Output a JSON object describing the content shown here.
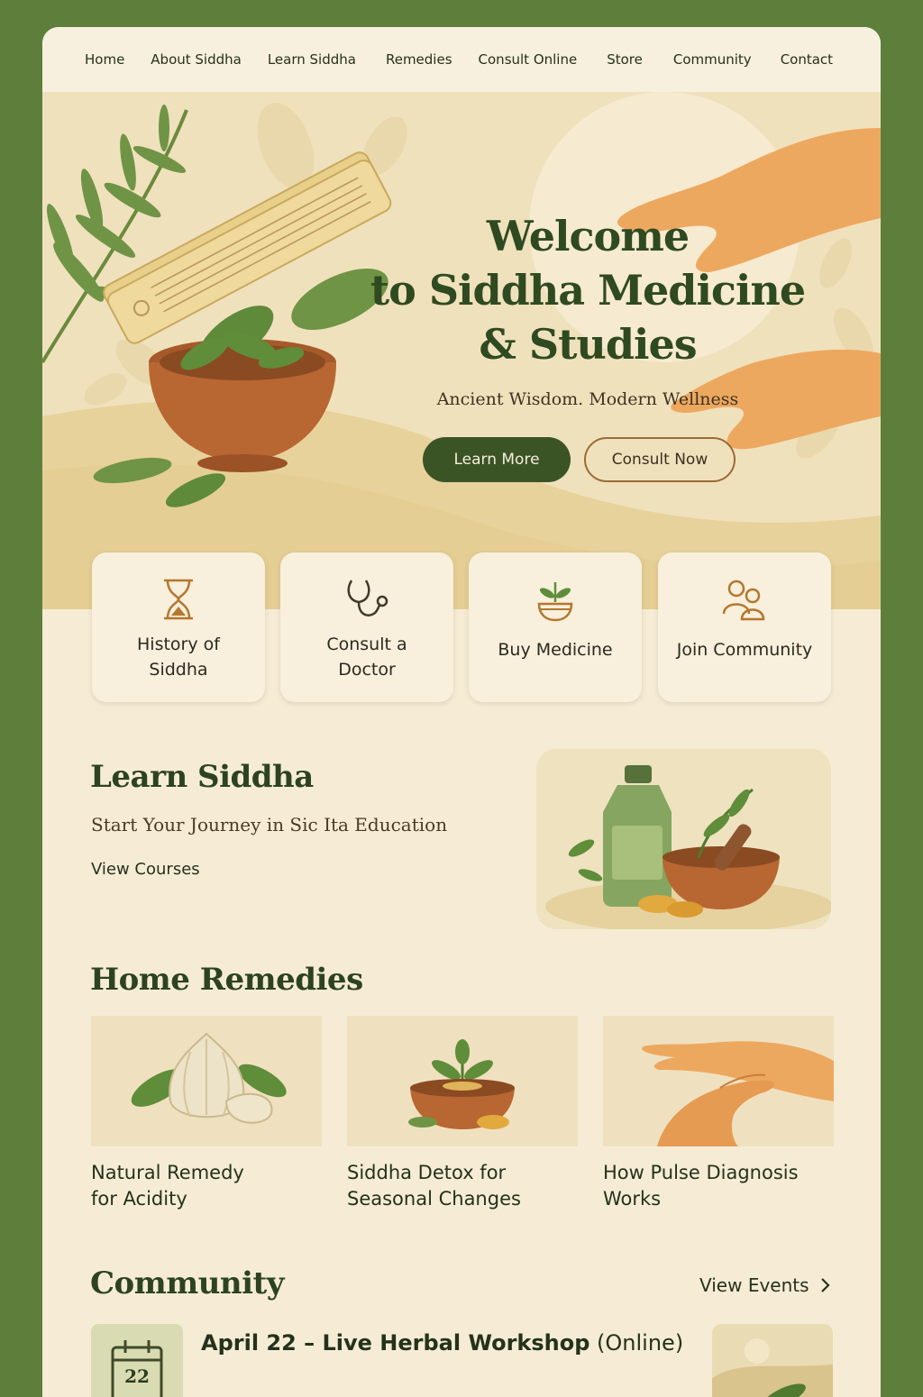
{
  "nav": {
    "items": [
      "Home",
      "About Siddha",
      "Learn Siddha",
      "Remedies",
      "Consult Online",
      "Store",
      "Community",
      "Contact"
    ]
  },
  "hero": {
    "title_line1": "Welcome",
    "title_line2": "to Siddha Medicine",
    "title_line3": "& Studies",
    "subtitle": "Ancient Wisdom. Modern Wellness",
    "primary_button": "Learn More",
    "secondary_button": "Consult Now"
  },
  "quick_links": [
    {
      "label_line1": "History of",
      "label_line2": "Siddha",
      "icon": "hourglass-icon"
    },
    {
      "label_line1": "Consult a",
      "label_line2": "Doctor",
      "icon": "stethoscope-icon"
    },
    {
      "label_line1": "Buy Medicine",
      "label_line2": "",
      "icon": "herb-bowl-icon"
    },
    {
      "label_line1": "Join Community",
      "label_line2": "",
      "icon": "people-icon"
    }
  ],
  "learn": {
    "title": "Learn Siddha",
    "subtitle": "Start Your Journey in Sic Ita Education",
    "link": "View Courses"
  },
  "remedies": {
    "title": "Home Remedies",
    "items": [
      {
        "line1": "Natural Remedy",
        "line2": "for Acidity"
      },
      {
        "line1": "Siddha Detox for",
        "line2": "Seasonal Changes"
      },
      {
        "line1": "How Pulse Diagnosis",
        "line2": "Works"
      }
    ]
  },
  "community": {
    "title": "Community",
    "events_link": "View Events",
    "event_title": "April 22 – Live Herbal Workshop",
    "event_suffix": " (Online)",
    "calendar_day": "22"
  },
  "colors": {
    "page_green": "#5e7f3c",
    "cream": "#f6ecd6",
    "dark_green": "#3b5426",
    "accent_brown": "#9b6a34"
  }
}
